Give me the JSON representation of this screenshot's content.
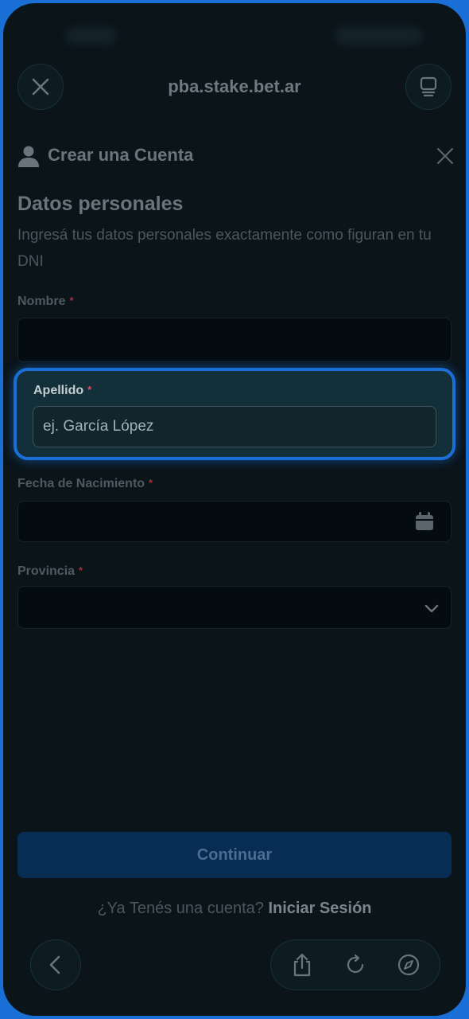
{
  "browser": {
    "url": "pba.stake.bet.ar",
    "close_icon": "close-icon",
    "tabs_icon": "tabs-icon"
  },
  "sheet": {
    "title": "Crear una Cuenta",
    "user_icon": "user-icon",
    "close_icon": "close-icon"
  },
  "section": {
    "title": "Datos personales",
    "description": "Ingresá tus datos personales exactamente como figuran en tu DNI"
  },
  "fields": {
    "nombre": {
      "label": "Nombre",
      "required_mark": "*",
      "value": ""
    },
    "apellido": {
      "label": "Apellido",
      "required_mark": "*",
      "placeholder": "ej. García López"
    },
    "fecha": {
      "label": "Fecha de Nacimiento",
      "required_mark": "*",
      "value": "",
      "icon": "calendar-icon"
    },
    "provincia": {
      "label": "Provincia",
      "required_mark": "*",
      "value": "",
      "icon": "chevron-down-icon"
    }
  },
  "actions": {
    "continue_label": "Continuar",
    "login_prompt": "¿Ya Tenés una cuenta?",
    "login_link": "Iniciar Sesión"
  },
  "toolbar": {
    "back_icon": "chevron-left-icon",
    "share_icon": "share-icon",
    "reload_icon": "reload-icon",
    "compass_icon": "compass-icon"
  },
  "colors": {
    "accent": "#1a6fd6",
    "background": "#0a1419",
    "button": "#072d54"
  }
}
